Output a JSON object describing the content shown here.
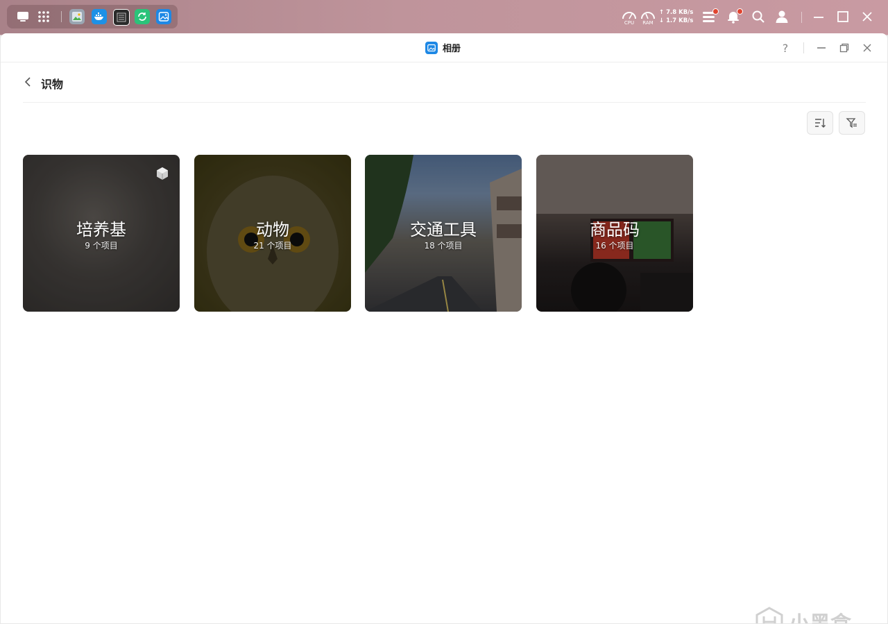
{
  "system_bar": {
    "net_up": "7.8 KB/s",
    "net_down": "1.7 KB/s",
    "cpu_label": "CPU",
    "ram_label": "RAM"
  },
  "window": {
    "title": "相册",
    "help": "?"
  },
  "page": {
    "title": "识物"
  },
  "albums": [
    {
      "name": "培养基",
      "count": "9 个项目"
    },
    {
      "name": "动物",
      "count": "21 个项目"
    },
    {
      "name": "交通工具",
      "count": "18 个项目"
    },
    {
      "name": "商品码",
      "count": "16 个项目"
    }
  ],
  "watermark": "小黑盒"
}
